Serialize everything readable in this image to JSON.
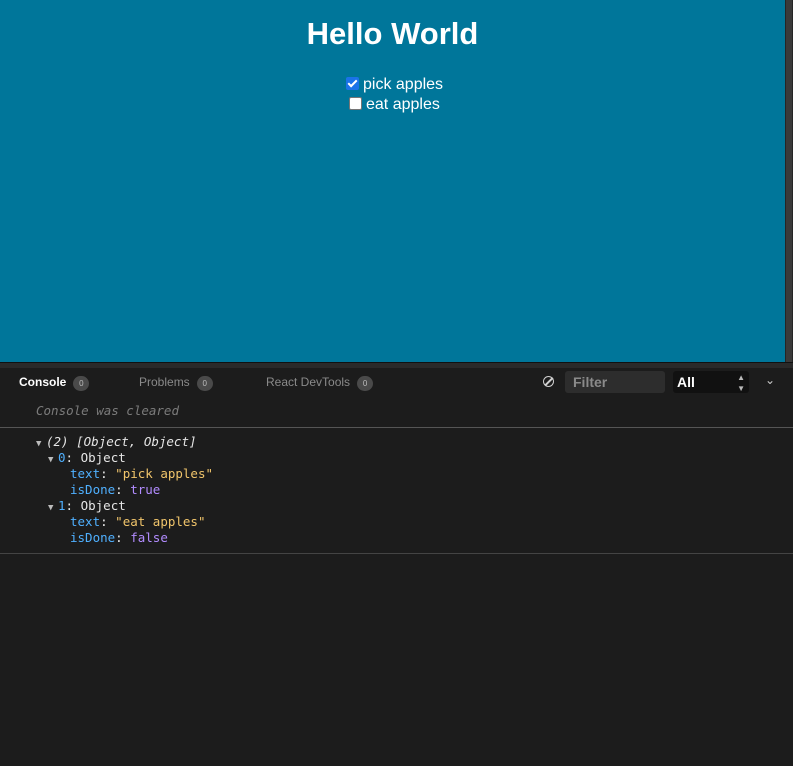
{
  "preview": {
    "title": "Hello World",
    "todos": [
      {
        "text": "pick apples",
        "checked": true
      },
      {
        "text": "eat apples",
        "checked": false
      }
    ]
  },
  "devtools": {
    "tabs": [
      {
        "label": "Console",
        "count": "0"
      },
      {
        "label": "Problems",
        "count": "0"
      },
      {
        "label": "React DevTools",
        "count": "0"
      }
    ],
    "filter_placeholder": "Filter",
    "level_selected": "All",
    "cleared_message": "Console was cleared",
    "log": {
      "summary": "(2) [Object, Object]",
      "items": [
        {
          "index": "0",
          "type": "Object",
          "text_key": "text",
          "text_value": "\"pick apples\"",
          "done_key": "isDone",
          "done_value": "true"
        },
        {
          "index": "1",
          "type": "Object",
          "text_key": "text",
          "text_value": "\"eat apples\"",
          "done_key": "isDone",
          "done_value": "false"
        }
      ]
    }
  },
  "colors": {
    "preview_bg": "#00769a",
    "devtools_bg": "#1c1c1c",
    "checkbox_accent": "#1a73e8"
  }
}
